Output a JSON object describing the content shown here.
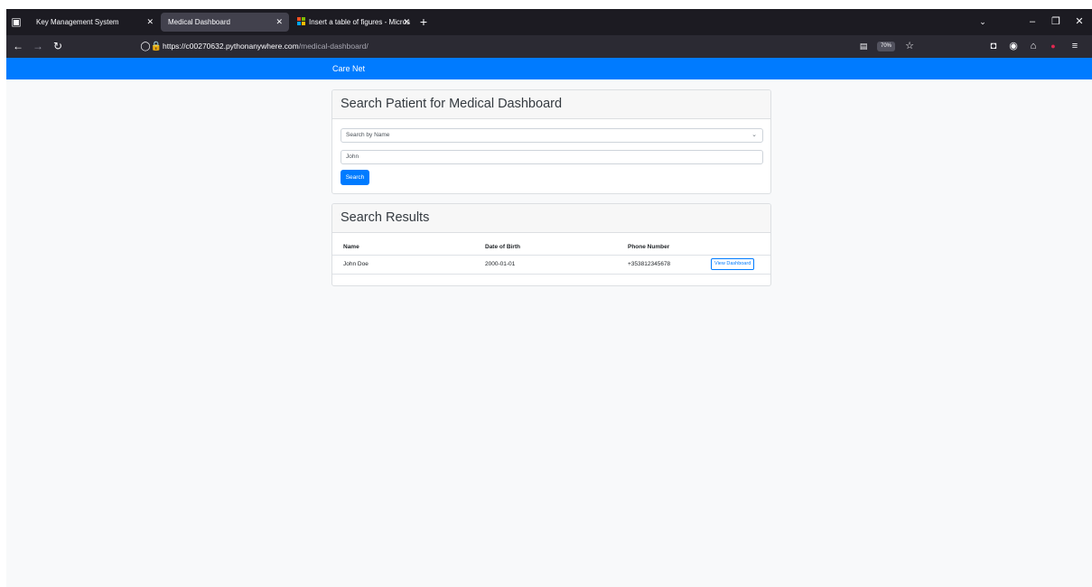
{
  "browser": {
    "tabs": [
      {
        "title": "Key Management System",
        "active": false
      },
      {
        "title": "Medical Dashboard",
        "active": true
      },
      {
        "title": "Insert a table of figures - Micros",
        "active": false
      }
    ],
    "url_host": "https://c00270632.pythonanywhere.com",
    "url_path": "/medical-dashboard/",
    "zoom": "70%"
  },
  "navbar": {
    "brand": "Care Net"
  },
  "search": {
    "title": "Search Patient for Medical Dashboard",
    "filter_selected": "Search by Name",
    "query_value": "John",
    "button_label": "Search"
  },
  "results": {
    "title": "Search Results",
    "columns": [
      "Name",
      "Date of Birth",
      "Phone Number"
    ],
    "rows": [
      {
        "name": "John Doe",
        "dob": "2000-01-01",
        "phone": "+353812345678",
        "action_label": "View Dashboard"
      }
    ]
  },
  "colors": {
    "primary": "#007bff",
    "browser_chrome": "#1c1b22",
    "page_bg": "#f8f9fa"
  },
  "icons": [
    "tab-manager-icon",
    "close-icon",
    "new-tab-icon",
    "back-icon",
    "forward-icon",
    "reload-icon",
    "shield-icon",
    "lock-icon",
    "reader-view-icon",
    "star-icon",
    "pocket-icon",
    "account-icon",
    "extensions-icon",
    "menu-icon",
    "list-all-tabs-icon",
    "minimize-icon",
    "maximize-icon"
  ]
}
